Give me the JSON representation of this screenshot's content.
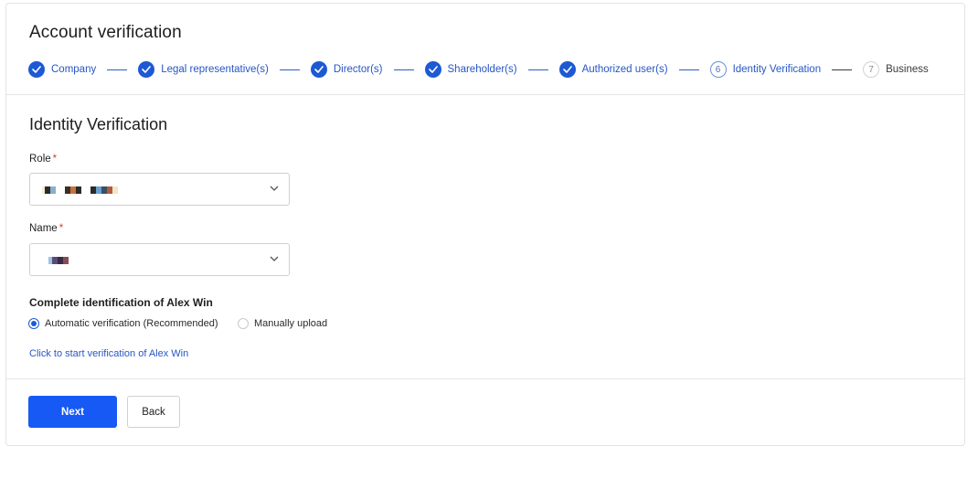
{
  "page": {
    "title": "Account verification"
  },
  "stepper": {
    "steps": [
      {
        "label": "Company",
        "status": "done"
      },
      {
        "label": "Legal representative(s)",
        "status": "done"
      },
      {
        "label": "Director(s)",
        "status": "done"
      },
      {
        "label": "Shareholder(s)",
        "status": "done"
      },
      {
        "label": "Authorized user(s)",
        "status": "done"
      },
      {
        "number": "6",
        "label": "Identity Verification",
        "status": "current"
      },
      {
        "number": "7",
        "label": "Business",
        "status": "pending"
      }
    ]
  },
  "form": {
    "section_title": "Identity Verification",
    "role": {
      "label": "Role",
      "required_mark": "*",
      "value_redacted": true
    },
    "name": {
      "label": "Name",
      "required_mark": "*",
      "value_redacted": true
    },
    "identification_heading": "Complete identification of Alex Win",
    "options": [
      {
        "label": "Automatic verification (Recommended)",
        "checked": true
      },
      {
        "label": "Manually upload",
        "checked": false
      }
    ],
    "verify_link": "Click to start verification of Alex Win"
  },
  "actions": {
    "next_label": "Next",
    "back_label": "Back"
  },
  "colors": {
    "accent": "#1659f5",
    "link": "#2656c4",
    "required": "#e0382f"
  }
}
